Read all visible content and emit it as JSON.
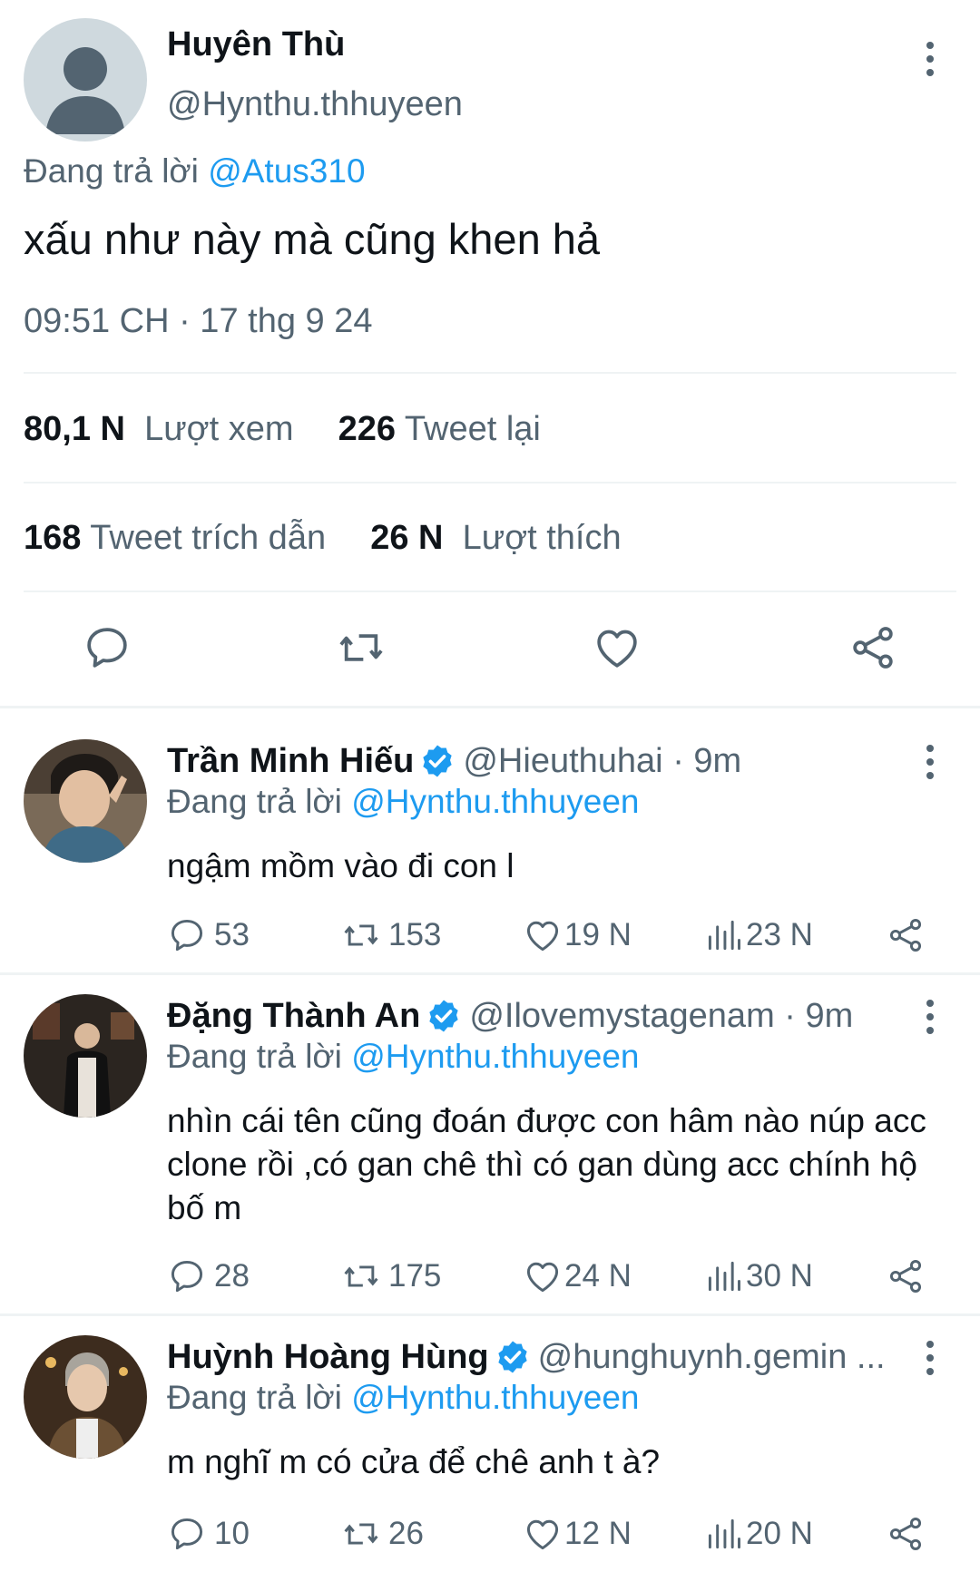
{
  "main_tweet": {
    "author_name": "Huyên Thù",
    "author_handle": "@Hynthu.thhuyeen",
    "replying_prefix": "Đang trả lời",
    "replying_to": "@Atus310",
    "text": "xấu như này mà cũng khen hả",
    "timestamp": "09:51 CH · 17 thg 9 24",
    "stats": {
      "views_count": "80,1 N",
      "views_label": "Lượt xem",
      "retweets_count": "226",
      "retweets_label": "Tweet lại",
      "quotes_count": "168",
      "quotes_label": "Tweet trích dẫn",
      "likes_count": "26 N",
      "likes_label": "Lượt thích"
    },
    "actions": [
      "reply-icon",
      "retweet-icon",
      "heart-icon",
      "share-icon"
    ]
  },
  "replies": [
    {
      "name": "Trần Minh Hiếu",
      "handle": "@Hieuthuhai",
      "time": "· 9m",
      "replying_prefix": "Đang trả lời",
      "replying_to": "@Hynthu.thhuyeen",
      "text": "ngậm mồm vào đi con l",
      "replies": "53",
      "retweets": "153",
      "likes": "19 N",
      "views": "23 N"
    },
    {
      "name": "Đặng Thành An",
      "handle": "@Ilovemystagenam",
      "time": "· 9m",
      "replying_prefix": "Đang trả lời",
      "replying_to": "@Hynthu.thhuyeen",
      "text": "nhìn cái tên cũng đoán được con hâm nào núp acc clone rồi ,có gan chê thì có gan dùng acc chính hộ bố m",
      "replies": "28",
      "retweets": "175",
      "likes": "24 N",
      "views": "30 N"
    },
    {
      "name": "Huỳnh Hoàng Hùng",
      "handle": "@hunghuynh.gemin ...",
      "time": "",
      "replying_prefix": "Đang trả lời",
      "replying_to": "@Hynthu.thhuyeen",
      "text": "m nghĩ m có cửa để chê anh t à?",
      "replies": "10",
      "retweets": "26",
      "likes": "12 N",
      "views": "20 N"
    }
  ],
  "colors": {
    "accent": "#1d9bf0",
    "text_primary": "#0f1419",
    "text_secondary": "#536471",
    "divider": "#eff3f4"
  }
}
